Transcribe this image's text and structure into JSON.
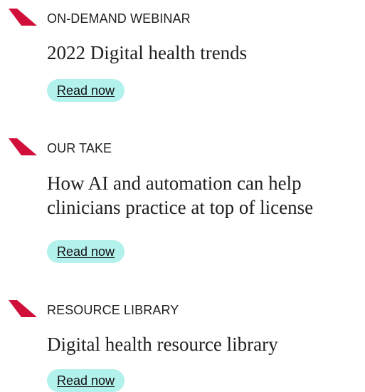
{
  "colors": {
    "accent_marker": "#d0103a",
    "button_bg": "#b3f1ec",
    "text": "#1f1f1f"
  },
  "items": [
    {
      "icon": "red-slash-marker-icon",
      "eyebrow": "ON-DEMAND WEBINAR",
      "title_lines": [
        "2022 Digital health trends"
      ],
      "cta": "Read now"
    },
    {
      "icon": "red-slash-marker-icon",
      "eyebrow": "OUR TAKE",
      "title_lines": [
        "How AI and automation can help",
        "clinicians practice at top of license"
      ],
      "cta": "Read now"
    },
    {
      "icon": "red-slash-marker-icon",
      "eyebrow": "RESOURCE LIBRARY",
      "title_lines": [
        "Digital health resource library"
      ],
      "cta": "Read now"
    }
  ]
}
